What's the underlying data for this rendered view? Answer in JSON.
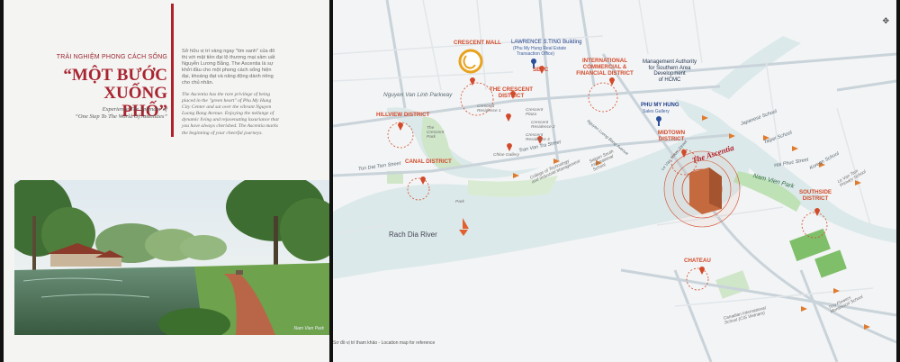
{
  "left_page": {
    "tagline": "TRẢI NGHIỆM PHONG CÁCH SỐNG",
    "headline_line1": "“MỘT BƯỚC",
    "headline_line2": "XUỐNG PHỐ”",
    "subtitle_line1": "Experience The Splendor of",
    "subtitle_line2": "“One Step To The World Of Amenities”",
    "body_vi": "Sở hữu vị trí vàng ngay \"tim xanh\" của đô thị với mật tiền đại lộ thương mại sầm uất Nguyễn Lương Bằng. The Ascentia là sự khởi đầu cho một phong cách sống hiện đại, khoáng đạt và năng động dành riêng cho chủ nhân.",
    "body_en": "The Ascentia has the rare privilege of being placed in the \"green heart\" of Phu My Hung City Center and sat over the vibrant Nguyen Luong Bang Avenue. Enjoying the mélange of dynamic living and rejuvenating luxuriance that you have always cherished. The Ascentia marks the beginning of your cheerful journeys.",
    "photo_caption": "Nam Vien Park"
  },
  "map": {
    "crescent_mall": "CRESCENT MALL",
    "lawrence": "LAWRENCE S.TING Building",
    "lawrence_sub1": "(Phu My Hung Real Estate",
    "lawrence_sub2": "Transaction Office)",
    "secc": "SECC",
    "intl_line1": "INTERNATIONAL",
    "intl_line2": "COMMERCIAL &",
    "intl_line3": "FINANCIAL DISTRICT",
    "mgmt_line1": "Management Authority",
    "mgmt_line2": "for Southern Area",
    "mgmt_line3": "Development",
    "mgmt_line4": "of HCMC",
    "nvl_parkway": "Nguyen Van Linh Parkway",
    "crescent_district_1": "THE CRESCENT",
    "crescent_district_2": "DISTRICT",
    "hillview": "HILLVIEW DISTRICT",
    "crescent_residence1": "Crescent Residence 1",
    "crescent_plaza": "Crescent Plaza",
    "crescent_residence2": "Crescent Residence 2",
    "crescent_residence3": "Crescent Residence 3",
    "crescent_park": "The Crescent Park",
    "pmh_line1": "PHU MY HUNG",
    "pmh_line2": "Sales Gallery",
    "midtown_1": "MIDTOWN",
    "midtown_2": "DISTRICT",
    "ascentia": "The Ascentia",
    "japanese_school": "Japanese School",
    "taipei_school": "Taipei School",
    "tan_dai_thanh": "Ton Dat Tien Street",
    "canal_district": "CANAL DISTRICT",
    "tran_van_tra": "Tran Van Tra Street",
    "chloe_gallery": "Chloe Gallery",
    "nlb_avenue": "Nguyen Luong Bang Avenue",
    "le_van_thiem": "Le Van Thiem Street",
    "college_1": "College of Technology",
    "college_2": "and Industrial Management",
    "saigon_south": "Saigon South International School",
    "nam_vien_park": "Nam Vien Park",
    "hai_phuc": "Hai Phuc Street",
    "korean_school": "Korean School",
    "le_van_tam": "Le Van Tam Primary School",
    "southside_1": "SOUTHSIDE",
    "southside_2": "DISTRICT",
    "park_label": "Park",
    "rach_dia": "Rach Dia River",
    "chateau": "CHATEAU",
    "canadian_1": "Canadian International",
    "canadian_2": "School (CIS Vietnam)",
    "tiny_flowers": "Tiny Flowers Montessori School",
    "footnote": "Sơ đồ vị trí tham khảo - Location map for reference"
  },
  "colors": {
    "accent_red": "#b0202a",
    "district_orange": "#d24a2a",
    "water": "#dce9ea",
    "park_green": "#7fbf6a",
    "building_brick": "#c56a3f"
  }
}
